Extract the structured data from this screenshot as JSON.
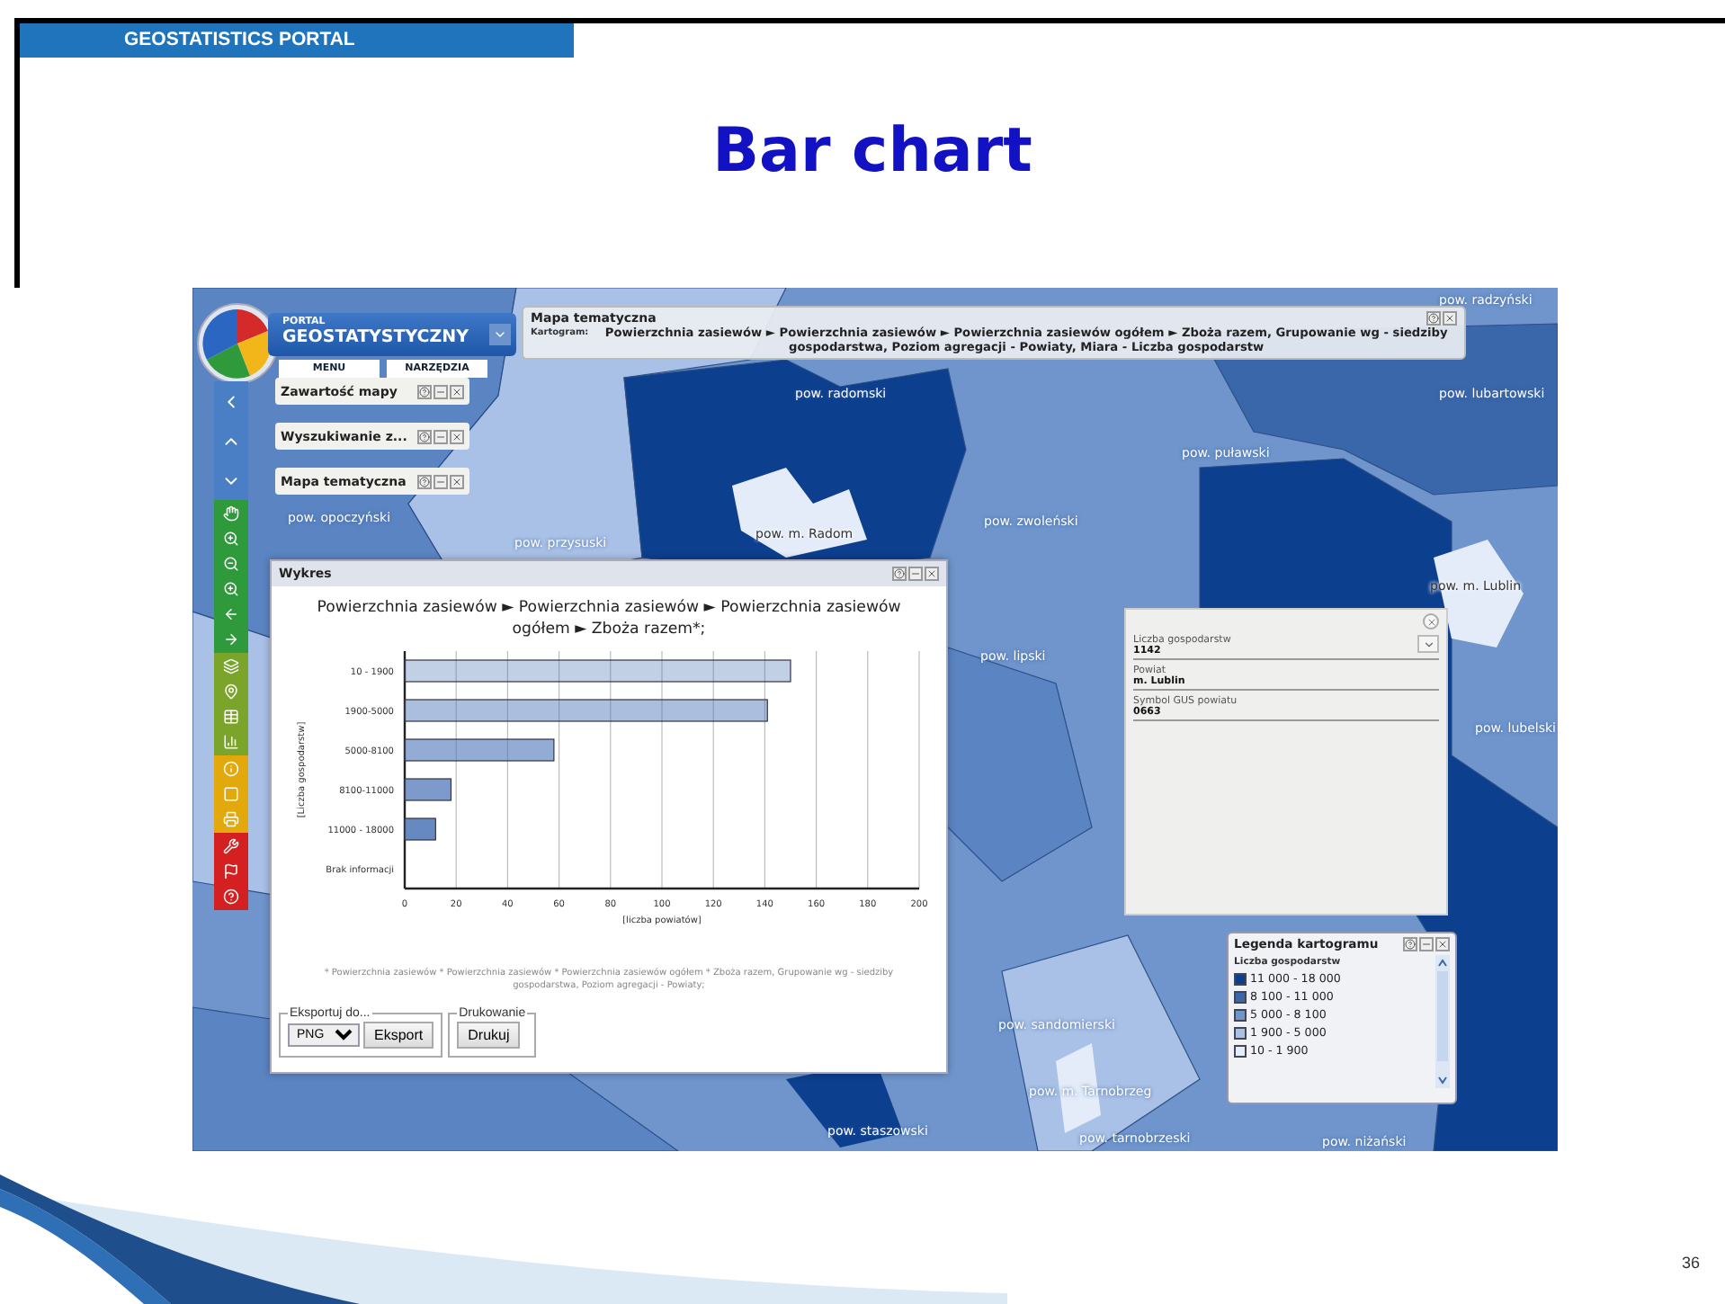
{
  "slide": {
    "header": "GEOSTATISTICS PORTAL",
    "title": "Bar chart",
    "page_number": "36"
  },
  "app": {
    "logo": {
      "small": "PORTAL",
      "large": "GEOSTATYSTYCZNY"
    },
    "menu": [
      "MENU",
      "NARZĘDZIA"
    ],
    "panels": [
      "Zawartość mapy",
      "Wyszukiwanie z...",
      "Mapa tematyczna"
    ],
    "theme_bar": {
      "title": "Mapa tematyczna",
      "label": "Kartogram:",
      "text": "Powierzchnia zasiewów ► Powierzchnia zasiewów ► Powierzchnia zasiewów ogółem ► Zboża razem, Grupowanie wg - siedziby gospodarstwa, Poziom agregacji - Powiaty, Miara - Liczba gospodarstw"
    },
    "map_labels": [
      "pow. radzyński",
      "pow. radomski",
      "pow. lubartowski",
      "pow. puławski",
      "pow. opoczyński",
      "pow. zwoleński",
      "pow. m. Radom",
      "pow. przysuski",
      "pow. m. Lublin",
      "pow. lipski",
      "pow. lubelski",
      "pow. sandomierski",
      "pow. m. Tarnobrzeg",
      "pow. staszowski",
      "pow. tarnobrzeski",
      "pow. niżański"
    ],
    "chart_window": {
      "title": "Wykres",
      "chart_data": {
        "type": "bar",
        "orientation": "horizontal",
        "title": "Powierzchnia zasiewów ► Powierzchnia zasiewów ► Powierzchnia zasiewów ogółem ► Zboża razem*;",
        "xlabel": "[liczba powiatów]",
        "ylabel": "[Liczba gospodarstw]",
        "categories": [
          "10 - 1900",
          "1900-5000",
          "5000-8100",
          "8100-11000",
          "11000 - 18000",
          "Brak informacji"
        ],
        "series": [
          {
            "color": "#4f77b8",
            "values": [
              150,
              141,
              58,
              18,
              12,
              0
            ]
          }
        ],
        "grid": true,
        "xlim": [
          0,
          200
        ],
        "xticks": [
          0,
          20,
          40,
          60,
          80,
          100,
          120,
          140,
          160,
          180,
          200
        ]
      },
      "footnote": "* Powierzchnia zasiewów * Powierzchnia zasiewów * Powierzchnia zasiewów ogółem * Zboża razem, Grupowanie wg - siedziby gospodarstwa, Poziom agregacji - Powiaty;",
      "export": {
        "legend": "Eksportuj do...",
        "format": "PNG",
        "button": "Eksport"
      },
      "print": {
        "legend": "Drukowanie",
        "button": "Drukuj"
      }
    },
    "info_popup": {
      "fields": [
        {
          "label": "Liczba gospodarstw",
          "value": "1142"
        },
        {
          "label": "Powiat",
          "value": "m. Lublin"
        },
        {
          "label": "Symbol GUS powiatu",
          "value": "0663"
        }
      ]
    },
    "legend": {
      "title": "Legenda kartogramu",
      "subtitle": "Liczba gospodarstw",
      "items": [
        {
          "label": "11 000 - 18 000",
          "color": "#0d3f8f"
        },
        {
          "label": "8 100 - 11 000",
          "color": "#3a66aa"
        },
        {
          "label": "5 000 - 8 100",
          "color": "#6f95cc"
        },
        {
          "label": "1 900 - 5 000",
          "color": "#a9c1e6"
        },
        {
          "label": "10 - 1 900",
          "color": "#e4ecf9"
        }
      ]
    }
  }
}
